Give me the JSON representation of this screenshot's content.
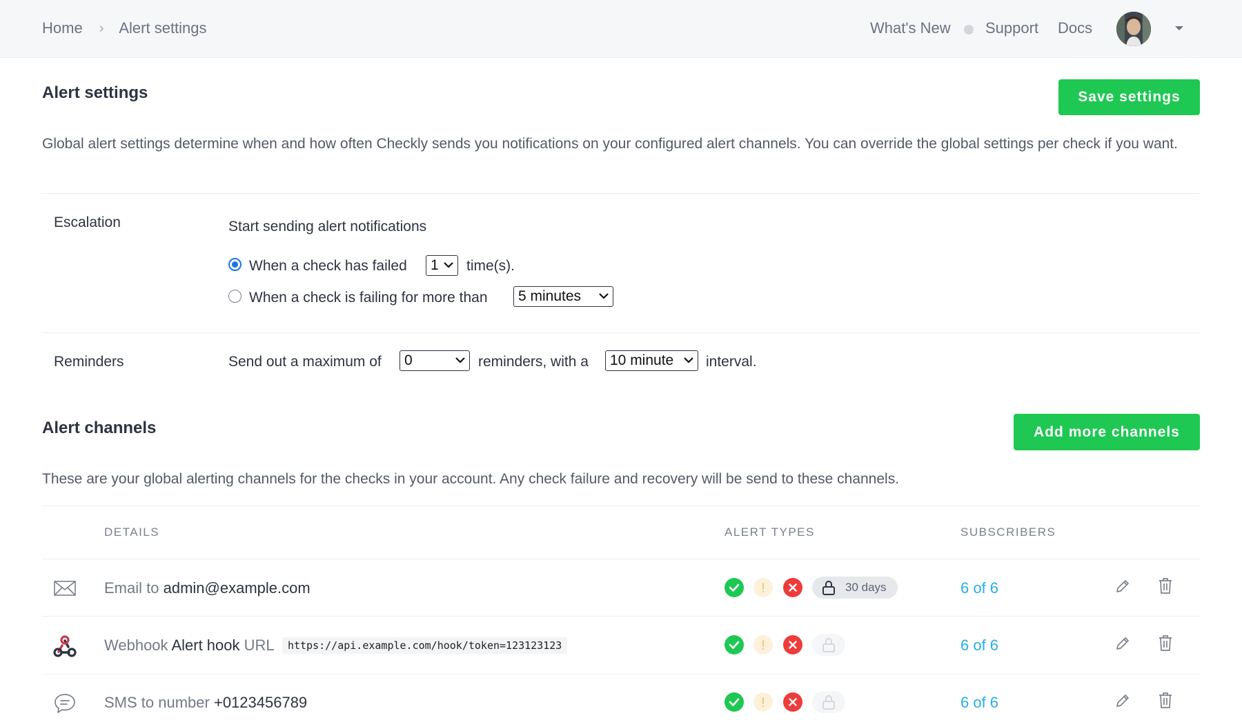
{
  "breadcrumb": {
    "home": "Home",
    "current": "Alert settings"
  },
  "topnav": {
    "whats_new": "What's New",
    "support": "Support",
    "docs": "Docs"
  },
  "settings": {
    "title": "Alert settings",
    "save_label": "Save settings",
    "description": "Global alert settings determine when and how often Checkly sends you notifications on your configured alert channels. You can override the global settings per check if you want."
  },
  "escalation": {
    "label": "Escalation",
    "heading": "Start sending alert notifications",
    "option1_text": "When a check has failed",
    "option1_value": "1",
    "option1_suffix": "time(s).",
    "option2_text": "When a check is failing for more than",
    "option2_value": "5 minutes",
    "selected": "option1"
  },
  "reminders": {
    "label": "Reminders",
    "prefix": "Send out a maximum of",
    "count": "0",
    "middle": "reminders, with a",
    "interval": "10 minute",
    "suffix": "interval."
  },
  "channels": {
    "title": "Alert channels",
    "add_label": "Add more channels",
    "description": "These are your global alerting channels for the checks in your account. Any check failure and recovery will be send to these channels.",
    "headers": {
      "details": "DETAILS",
      "alert_types": "ALERT TYPES",
      "subscribers": "SUBSCRIBERS"
    },
    "rows": [
      {
        "icon": "envelope-icon",
        "prefix": "Email to",
        "target": "admin@example.com",
        "lock_label": "30 days",
        "subscribers": "6 of 6"
      },
      {
        "icon": "webhook-icon",
        "prefix": "Webhook",
        "name": "Alert hook",
        "url_label": "URL",
        "url": "https://api.example.com/hook/token=123123123",
        "subscribers": "6 of 6"
      },
      {
        "icon": "chat-bubble-icon",
        "prefix": "SMS to number",
        "target": "+0123456789",
        "subscribers": "6 of 6"
      }
    ]
  },
  "colors": {
    "accent": "#1ec853",
    "link": "#27aee4",
    "success": "#1ec853",
    "error": "#ef3b3b",
    "warning": "#fdf1dc"
  }
}
